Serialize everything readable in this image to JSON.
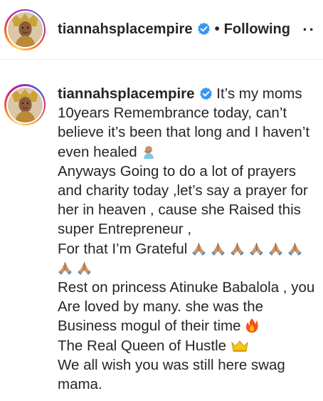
{
  "header": {
    "username": "tiannahsplacempire",
    "separator": "•",
    "follow_status": "Following",
    "more_label": "··"
  },
  "caption": {
    "username": "tiannahsplacempire",
    "lines": [
      " It’s my moms",
      "10years Remembrance today, can’t",
      "believe it’s been that long and I haven’t",
      "even healed",
      "Anyways Going to do a lot of prayers",
      "and charity today ,let’s say a prayer for",
      "her in heaven , cause she Raised this",
      "super Entrepreneur ,",
      "For that I’m Grateful",
      "",
      "Rest on princess Atinuke Babalola , you",
      "Are loved by many. she was the",
      "Business mogul of their time",
      "The Real Queen of Hustle",
      "We all wish you was still here swag",
      "mama."
    ]
  },
  "colors": {
    "verified_blue": "#3897f0",
    "text": "#262626",
    "skin": "#c9956b"
  }
}
